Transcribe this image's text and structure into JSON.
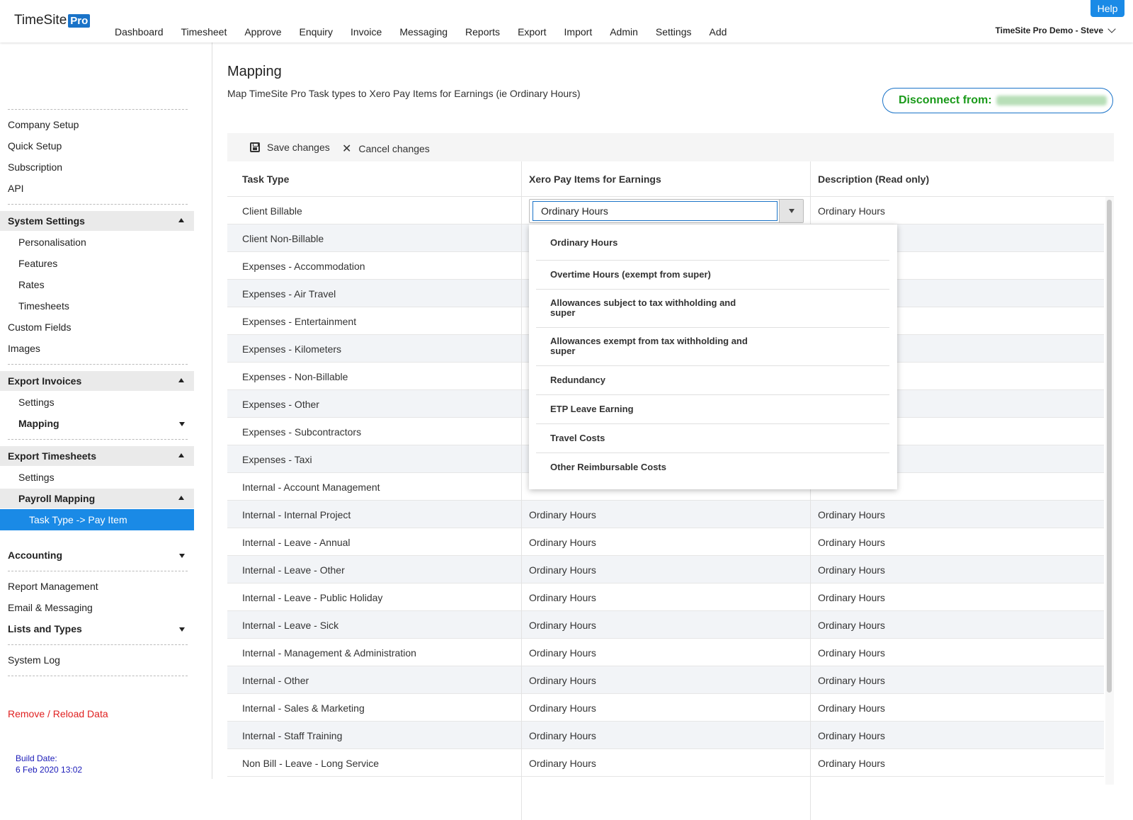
{
  "app": {
    "logo_text": "TimeSite",
    "logo_badge": "Pro",
    "help": "Help",
    "user": "TimeSite Pro Demo - Steve"
  },
  "nav": [
    "Dashboard",
    "Timesheet",
    "Approve",
    "Enquiry",
    "Invoice",
    "Messaging",
    "Reports",
    "Export",
    "Import",
    "Admin",
    "Settings",
    "Add"
  ],
  "sidebar": {
    "company_setup": "Company Setup",
    "quick_setup": "Quick Setup",
    "subscription": "Subscription",
    "api": "API",
    "system_settings": "System Settings",
    "personalisation": "Personalisation",
    "features": "Features",
    "rates": "Rates",
    "timesheets": "Timesheets",
    "custom_fields": "Custom Fields",
    "images": "Images",
    "export_invoices": "Export Invoices",
    "ei_settings": "Settings",
    "ei_mapping": "Mapping",
    "export_timesheets": "Export Timesheets",
    "et_settings": "Settings",
    "payroll_mapping": "Payroll Mapping",
    "task_type_pay_item": "Task Type -> Pay Item",
    "accounting": "Accounting",
    "report_management": "Report Management",
    "email_messaging": "Email & Messaging",
    "lists_types": "Lists and Types",
    "system_log": "System Log",
    "remove_reload": "Remove / Reload Data",
    "build_label": "Build Date:",
    "build_date": "6 Feb 2020 13:02"
  },
  "main": {
    "title": "Mapping",
    "subtitle": "Map TimeSite Pro Task types to Xero Pay Items for Earnings (ie Ordinary Hours)",
    "disconnect": "Disconnect from:",
    "save": "Save changes",
    "cancel": "Cancel changes",
    "columns": [
      "Task Type",
      "Xero Pay Items for Earnings",
      "Description (Read only)"
    ],
    "combo_value": "Ordinary Hours",
    "rows": [
      {
        "task": "Client Billable",
        "pay_item": "",
        "desc": "Ordinary Hours"
      },
      {
        "task": "Client Non-Billable",
        "pay_item": "",
        "desc": ""
      },
      {
        "task": "Expenses - Accommodation",
        "pay_item": "",
        "desc": ""
      },
      {
        "task": "Expenses - Air Travel",
        "pay_item": "",
        "desc": ""
      },
      {
        "task": "Expenses - Entertainment",
        "pay_item": "",
        "desc": ""
      },
      {
        "task": "Expenses - Kilometers",
        "pay_item": "",
        "desc": ""
      },
      {
        "task": "Expenses - Non-Billable",
        "pay_item": "",
        "desc": ""
      },
      {
        "task": "Expenses - Other",
        "pay_item": "",
        "desc": ""
      },
      {
        "task": "Expenses - Subcontractors",
        "pay_item": "",
        "desc": ""
      },
      {
        "task": "Expenses - Taxi",
        "pay_item": "",
        "desc": ""
      },
      {
        "task": "Internal - Account Management",
        "pay_item": "",
        "desc": ""
      },
      {
        "task": "Internal - Internal Project",
        "pay_item": "Ordinary Hours",
        "desc": "Ordinary Hours"
      },
      {
        "task": "Internal - Leave - Annual",
        "pay_item": "Ordinary Hours",
        "desc": "Ordinary Hours"
      },
      {
        "task": "Internal - Leave - Other",
        "pay_item": "Ordinary Hours",
        "desc": "Ordinary Hours"
      },
      {
        "task": "Internal - Leave - Public Holiday",
        "pay_item": "Ordinary Hours",
        "desc": "Ordinary Hours"
      },
      {
        "task": "Internal - Leave - Sick",
        "pay_item": "Ordinary Hours",
        "desc": "Ordinary Hours"
      },
      {
        "task": "Internal - Management & Administration",
        "pay_item": "Ordinary Hours",
        "desc": "Ordinary Hours"
      },
      {
        "task": "Internal - Other",
        "pay_item": "Ordinary Hours",
        "desc": "Ordinary Hours"
      },
      {
        "task": "Internal - Sales & Marketing",
        "pay_item": "Ordinary Hours",
        "desc": "Ordinary Hours"
      },
      {
        "task": "Internal - Staff Training",
        "pay_item": "Ordinary Hours",
        "desc": "Ordinary Hours"
      },
      {
        "task": "Non Bill - Leave - Long Service",
        "pay_item": "Ordinary Hours",
        "desc": "Ordinary Hours"
      }
    ],
    "dropdown_options": [
      "Ordinary Hours",
      "Overtime Hours (exempt from super)",
      "Allowances subject to tax withholding and super",
      "Allowances exempt from tax withholding and super",
      "Redundancy",
      "ETP Leave Earning",
      "Travel Costs",
      "Other Reimbursable Costs"
    ]
  }
}
